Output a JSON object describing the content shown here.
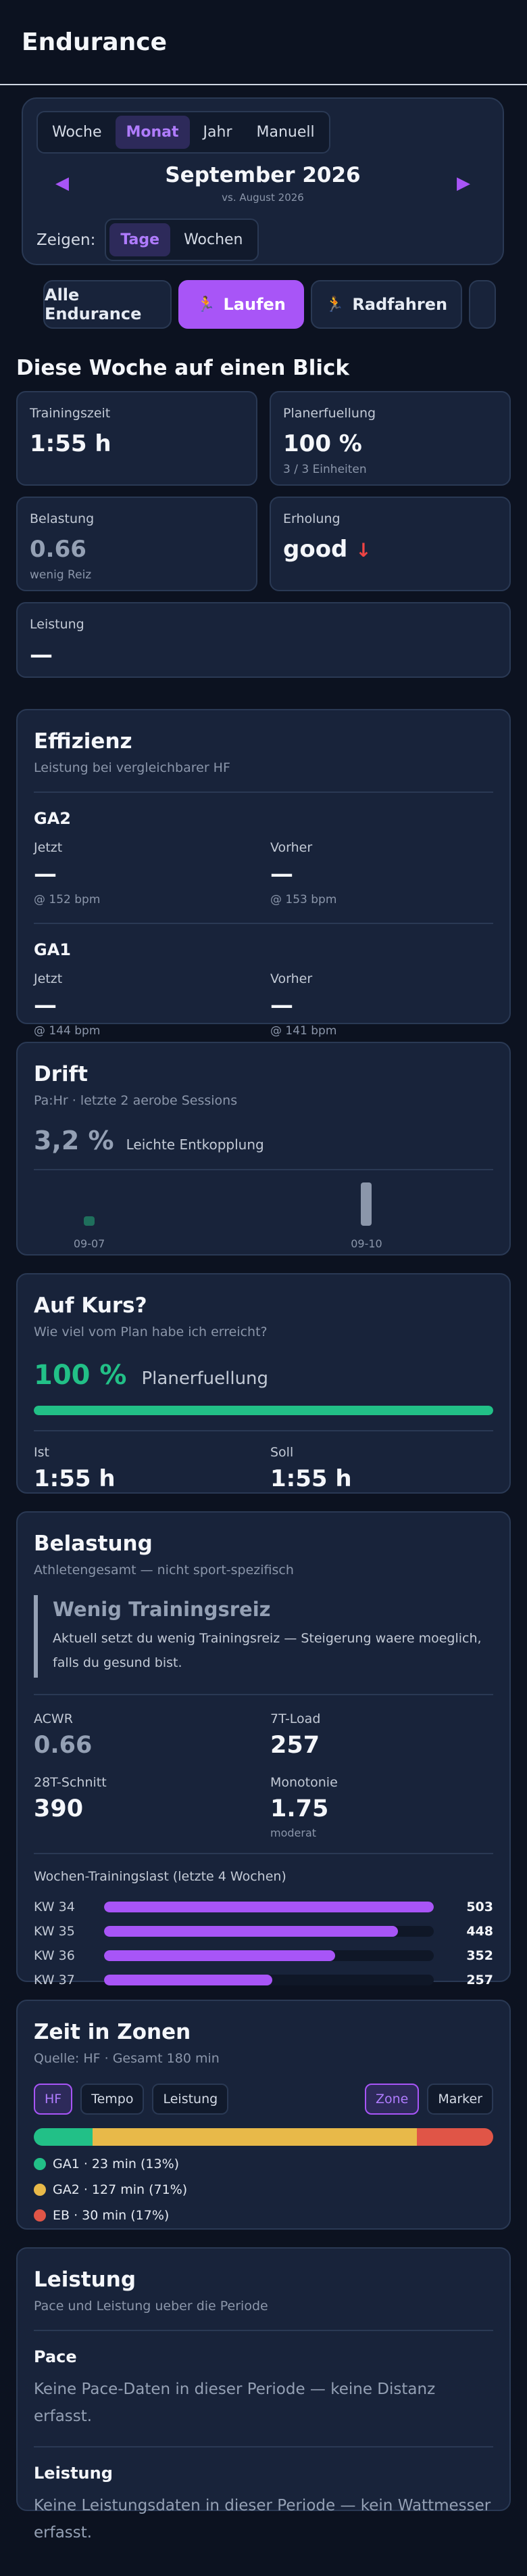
{
  "header": {
    "title": "Endurance"
  },
  "period": {
    "tabs": [
      {
        "label": "Woche",
        "active": false
      },
      {
        "label": "Monat",
        "active": true
      },
      {
        "label": "Jahr",
        "active": false
      },
      {
        "label": "Manuell",
        "active": false
      }
    ],
    "prev_icon": "triangle-left",
    "next_icon": "triangle-right",
    "title": "September 2026",
    "subtitle": "vs. August 2026",
    "show_label": "Zeigen:",
    "show_options": [
      {
        "label": "Tage",
        "active": true
      },
      {
        "label": "Wochen",
        "active": false
      }
    ]
  },
  "sports": [
    {
      "label": "Alle Endurance",
      "icon": "",
      "active": false
    },
    {
      "label": "Laufen",
      "icon": "runner-icon",
      "active": true
    },
    {
      "label": "Radfahren",
      "icon": "runner-icon",
      "active": false
    }
  ],
  "week": {
    "title": "Diese Woche auf einen Blick",
    "stats": {
      "trainingszeit": {
        "label": "Trainingszeit",
        "value": "1:55 h"
      },
      "planerfuellung": {
        "label": "Planerfuellung",
        "value": "100 %",
        "sub": "3 / 3 Einheiten"
      },
      "belastung": {
        "label": "Belastung",
        "value": "0.66",
        "sub": "wenig Reiz"
      },
      "erholung": {
        "label": "Erholung",
        "value": "good",
        "trend_icon": "↓"
      },
      "leistung": {
        "label": "Leistung",
        "value": "—"
      }
    }
  },
  "effizienz": {
    "title": "Effizienz",
    "subtitle": "Leistung bei vergleichbarer HF",
    "blocks": [
      {
        "name": "GA2",
        "now_label": "Jetzt",
        "now_value": "—",
        "now_sub": "@ 152 bpm",
        "prev_label": "Vorher",
        "prev_value": "—",
        "prev_sub": "@ 153 bpm"
      },
      {
        "name": "GA1",
        "now_label": "Jetzt",
        "now_value": "—",
        "now_sub": "@ 144 bpm",
        "prev_label": "Vorher",
        "prev_value": "—",
        "prev_sub": "@ 141 bpm"
      }
    ]
  },
  "drift": {
    "title": "Drift",
    "subtitle": "Pa:Hr · letzte 2 aerobe Sessions",
    "value": "3,2 %",
    "text": "Leichte Entkopplung",
    "chart_data": {
      "type": "bar",
      "categories": [
        "09-07",
        "09-10"
      ],
      "values": [
        0.4,
        3.2
      ],
      "colors": [
        "#1f6f5c",
        "#8b96aa"
      ]
    }
  },
  "kurs": {
    "title": "Auf Kurs?",
    "subtitle": "Wie viel vom Plan habe ich erreicht?",
    "pct": "100 %",
    "pct_label": "Planerfuellung",
    "progress": 1.0,
    "ist_label": "Ist",
    "ist_value": "1:55 h",
    "soll_label": "Soll",
    "soll_value": "1:55 h"
  },
  "belastung": {
    "title": "Belastung",
    "subtitle": "Athletengesamt — nicht sport-spezifisch",
    "box_title": "Wenig Trainingsreiz",
    "box_text": "Aktuell setzt du wenig Trainingsreiz — Steigerung waere moeglich, falls du gesund bist.",
    "metrics": {
      "acwr": {
        "label": "ACWR",
        "value": "0.66"
      },
      "load7": {
        "label": "7T-Load",
        "value": "257"
      },
      "avg28": {
        "label": "28T-Schnitt",
        "value": "390"
      },
      "monotonie": {
        "label": "Monotonie",
        "value": "1.75",
        "sub": "moderat"
      }
    },
    "weekly_title": "Wochen-Trainingslast (letzte 4 Wochen)",
    "chart_data": {
      "type": "bar",
      "categories": [
        "KW 34",
        "KW 35",
        "KW 36",
        "KW 37"
      ],
      "values": [
        503,
        448,
        352,
        257
      ],
      "xlim": [
        0,
        503
      ]
    }
  },
  "zonen": {
    "title": "Zeit in Zonen",
    "subtitle": "Quelle: HF · Gesamt 180 min",
    "source_chips": [
      {
        "label": "HF",
        "active": true
      },
      {
        "label": "Tempo",
        "active": false
      },
      {
        "label": "Leistung",
        "active": false
      }
    ],
    "mode_chips": [
      {
        "label": "Zone",
        "active": true
      },
      {
        "label": "Marker",
        "active": false
      }
    ],
    "chart_data": {
      "type": "bar",
      "series": [
        {
          "name": "GA1",
          "minutes": 23,
          "pct": 13,
          "color": "#22c087"
        },
        {
          "name": "GA2",
          "minutes": 127,
          "pct": 71,
          "color": "#e8b949"
        },
        {
          "name": "EB",
          "minutes": 30,
          "pct": 17,
          "color": "#e05547"
        }
      ]
    },
    "legend": [
      "GA1 · 23 min (13%)",
      "GA2 · 127 min (71%)",
      "EB · 30 min (17%)"
    ]
  },
  "leistung": {
    "title": "Leistung",
    "subtitle": "Pace und Leistung ueber die Periode",
    "pace_title": "Pace",
    "pace_text": "Keine Pace-Daten in dieser Periode — keine Distanz erfasst.",
    "power_title": "Leistung",
    "power_text": "Keine Leistungsdaten in dieser Periode — kein Wattmesser erfasst."
  }
}
